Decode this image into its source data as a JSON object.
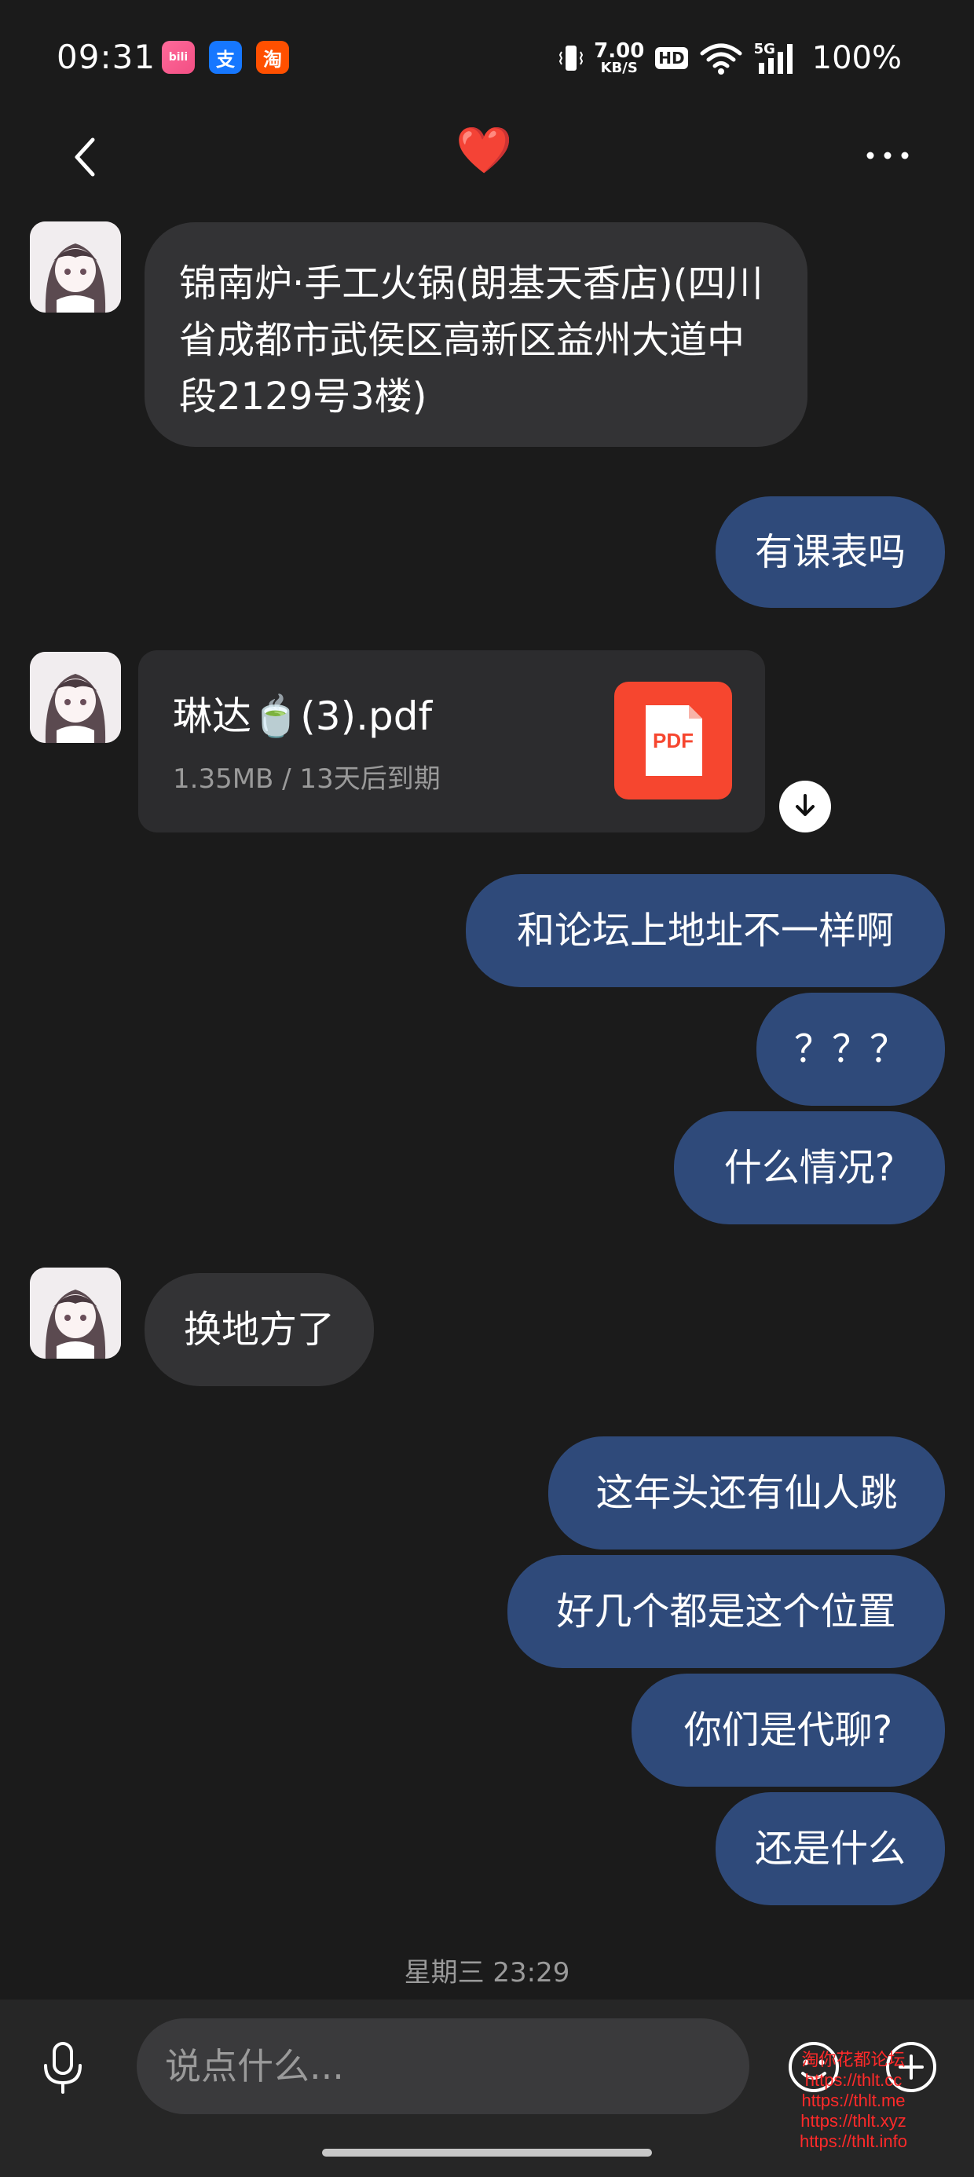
{
  "status_bar": {
    "time": "09:31",
    "apps": [
      {
        "name": "bilibili",
        "label": "bili"
      },
      {
        "name": "alipay",
        "label": "支"
      },
      {
        "name": "taobao",
        "label": "淘"
      }
    ],
    "net_speed_value": "7.00",
    "net_speed_unit": "KB/S",
    "hd_label": "HD",
    "network_type": "5G",
    "battery": "100%"
  },
  "header": {
    "title": "❤️",
    "title_color": "#e53935"
  },
  "messages": {
    "address": "锦南炉·手工火锅(朗基天香店)(四川省成都市武侯区高新区益州大道中段2129号3楼)",
    "m1": "有课表吗",
    "file": {
      "name": "琳达🍵(3).pdf",
      "meta": "1.35MB / 13天后到期",
      "icon_label": "PDF"
    },
    "m2": "和论坛上地址不一样啊",
    "m3": "？？？",
    "m4": "什么情况?",
    "m5": "换地方了",
    "m6": "这年头还有仙人跳",
    "m7": "好几个都是这个位置",
    "m8": "你们是代聊?",
    "m9": "还是什么"
  },
  "timestamp": "星期三 23:29",
  "input": {
    "placeholder": "说点什么..."
  },
  "watermark": {
    "title": "淘你花都论坛",
    "links": [
      "https://thlt.cc",
      "https://thlt.me",
      "https://thlt.xyz",
      "https://thlt.info"
    ]
  },
  "colors": {
    "background": "#1b1b1b",
    "incoming_bubble": "#333335",
    "outgoing_bubble": "#2f4a7a",
    "pdf_red": "#f6462f"
  }
}
